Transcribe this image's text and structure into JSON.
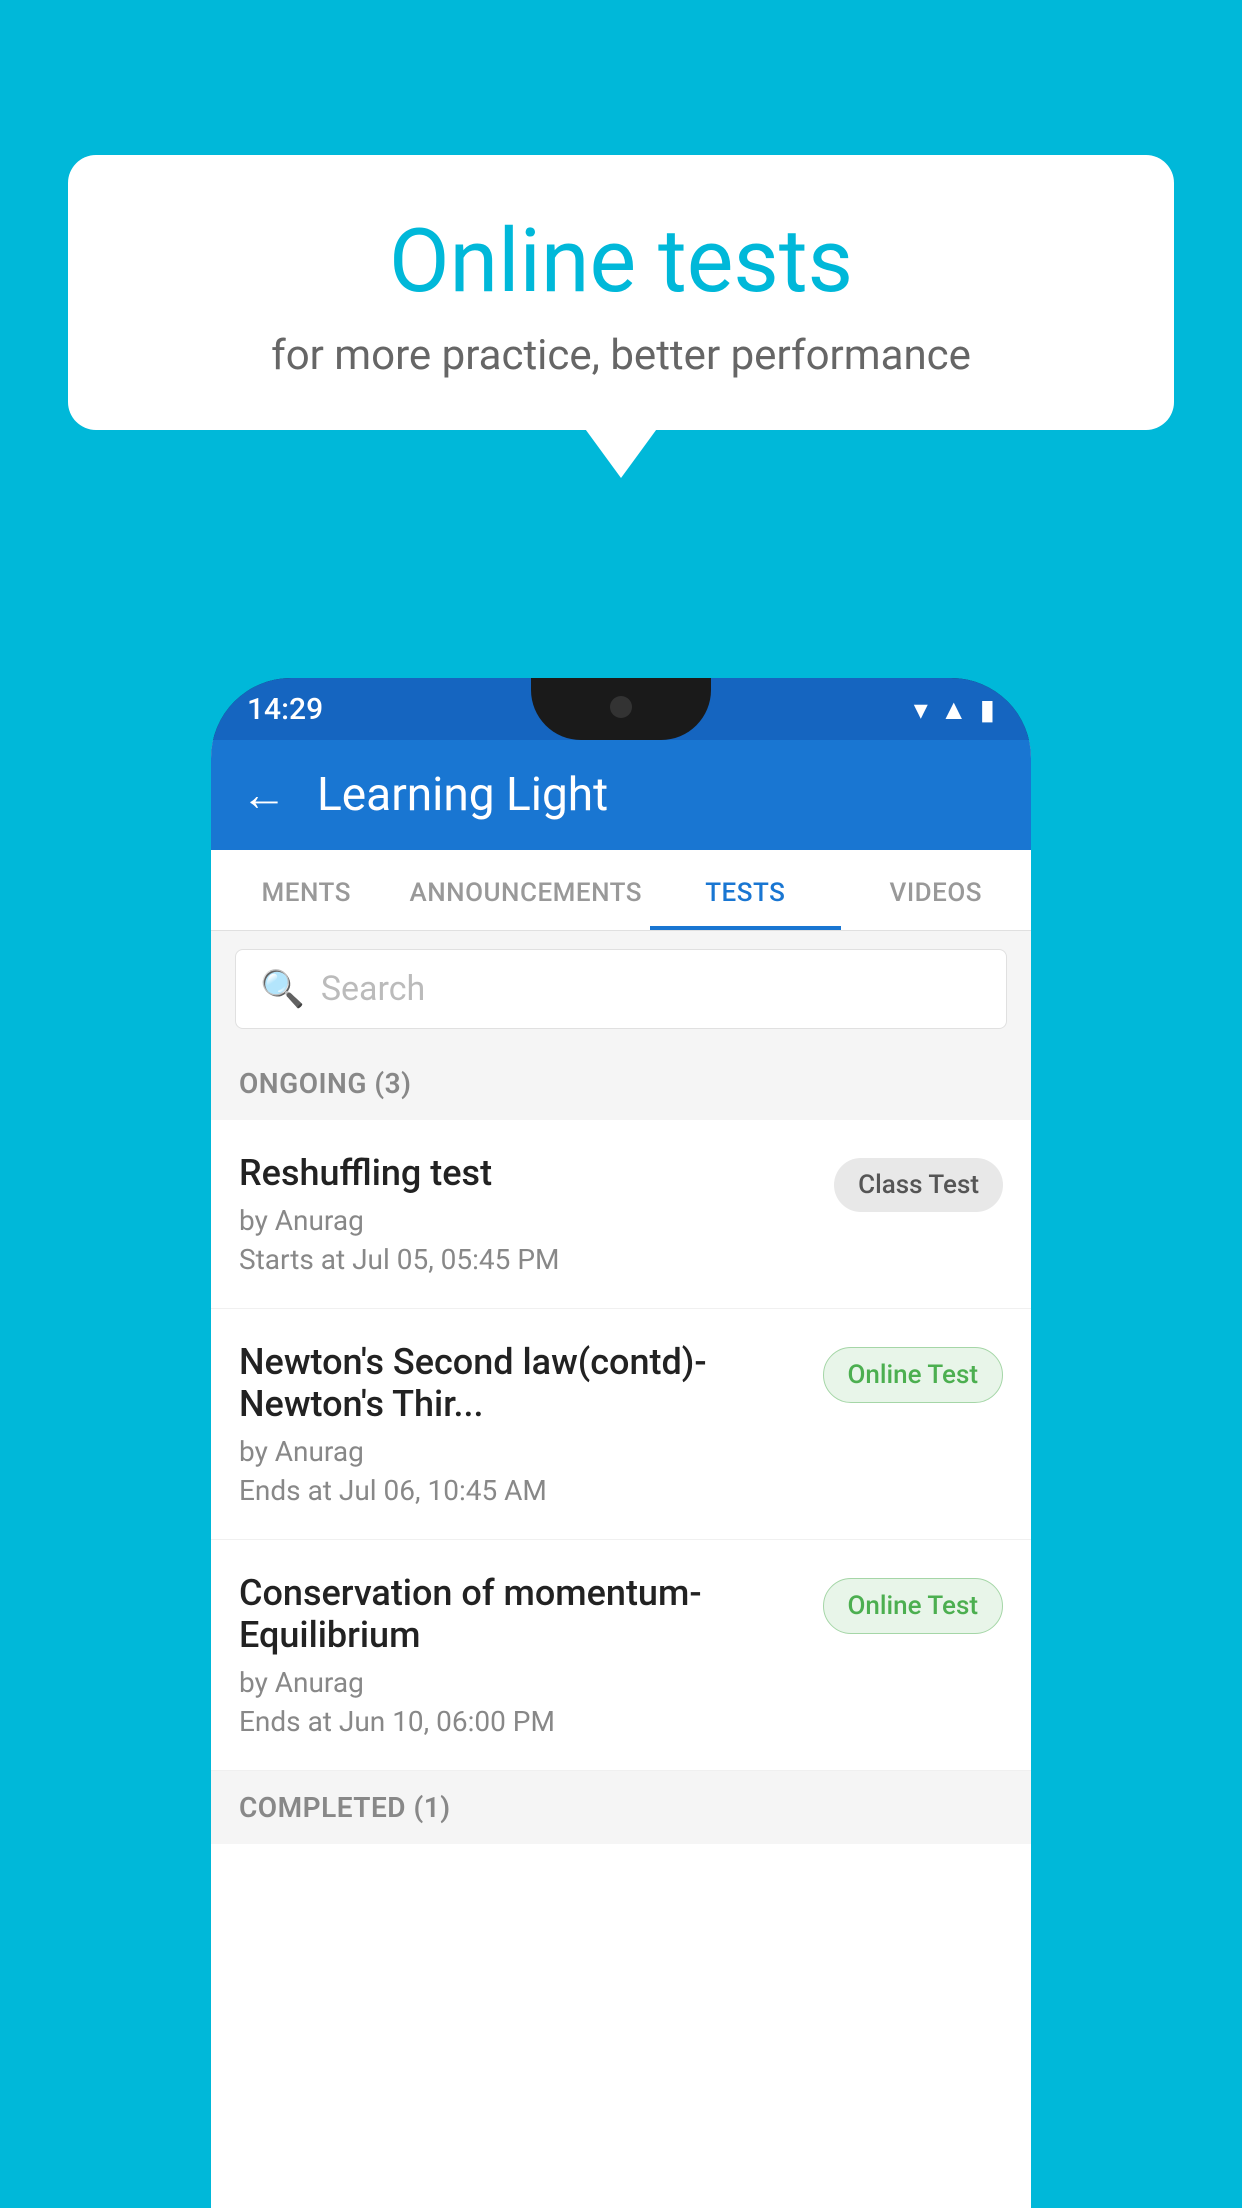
{
  "background_color": "#00b8d9",
  "speech_bubble": {
    "title": "Online tests",
    "subtitle": "for more practice, better performance"
  },
  "status_bar": {
    "time": "14:29",
    "icons": [
      "wifi",
      "signal",
      "battery"
    ]
  },
  "app_bar": {
    "title": "Learning Light",
    "back_label": "←"
  },
  "tabs": [
    {
      "label": "MENTS",
      "active": false
    },
    {
      "label": "ANNOUNCEMENTS",
      "active": false
    },
    {
      "label": "TESTS",
      "active": true
    },
    {
      "label": "VIDEOS",
      "active": false
    }
  ],
  "search": {
    "placeholder": "Search"
  },
  "ongoing_section": {
    "title": "ONGOING (3)",
    "items": [
      {
        "name": "Reshuffling test",
        "author": "by Anurag",
        "date": "Starts at  Jul 05, 05:45 PM",
        "badge": "Class Test",
        "badge_type": "class"
      },
      {
        "name": "Newton's Second law(contd)-Newton's Thir...",
        "author": "by Anurag",
        "date": "Ends at  Jul 06, 10:45 AM",
        "badge": "Online Test",
        "badge_type": "online"
      },
      {
        "name": "Conservation of momentum-Equilibrium",
        "author": "by Anurag",
        "date": "Ends at  Jun 10, 06:00 PM",
        "badge": "Online Test",
        "badge_type": "online"
      }
    ]
  },
  "completed_section": {
    "title": "COMPLETED (1)"
  }
}
